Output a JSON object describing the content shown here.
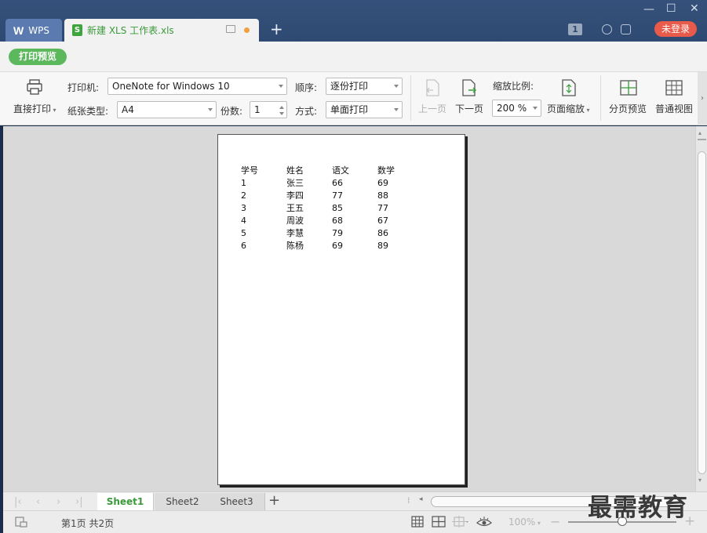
{
  "window": {
    "app_tab": "WPS",
    "doc_tab": "新建 XLS 工作表.xls",
    "new_tab_icon": "plus-icon",
    "badge_count": "1",
    "login_button": "未登录"
  },
  "mode": {
    "print_preview_label": "打印预览"
  },
  "toolbar": {
    "direct_print": "直接打印",
    "printer_label": "打印机:",
    "printer_value": "OneNote for Windows 10",
    "paper_label": "纸张类型:",
    "paper_value": "A4",
    "order_label": "顺序:",
    "order_value": "逐份打印",
    "copies_label": "份数:",
    "copies_value": "1",
    "method_label": "方式:",
    "method_value": "单面打印",
    "prev_page": "上一页",
    "next_page": "下一页",
    "zoom_ratio_label": "缩放比例:",
    "zoom_ratio_value": "200 %",
    "page_zoom": "页面缩放",
    "page_break_preview": "分页预览",
    "normal_view": "普通视图"
  },
  "sheet_table": {
    "headers": [
      "学号",
      "姓名",
      "语文",
      "数学"
    ],
    "rows": [
      [
        "1",
        "张三",
        "66",
        "69"
      ],
      [
        "2",
        "李四",
        "77",
        "88"
      ],
      [
        "3",
        "王五",
        "85",
        "77"
      ],
      [
        "4",
        "周波",
        "68",
        "67"
      ],
      [
        "5",
        "李慧",
        "79",
        "86"
      ],
      [
        "6",
        "陈杨",
        "69",
        "89"
      ]
    ]
  },
  "sheets": [
    "Sheet1",
    "Sheet2",
    "Sheet3"
  ],
  "status": {
    "page_info": "第1页 共2页",
    "zoom_level": "100%"
  },
  "watermark": "最需教育",
  "colors": {
    "titlebar": "#2e4a72",
    "accent_green": "#5cb85c",
    "login_red": "#e85a4a",
    "sheet_active": "#3a9a3a"
  }
}
